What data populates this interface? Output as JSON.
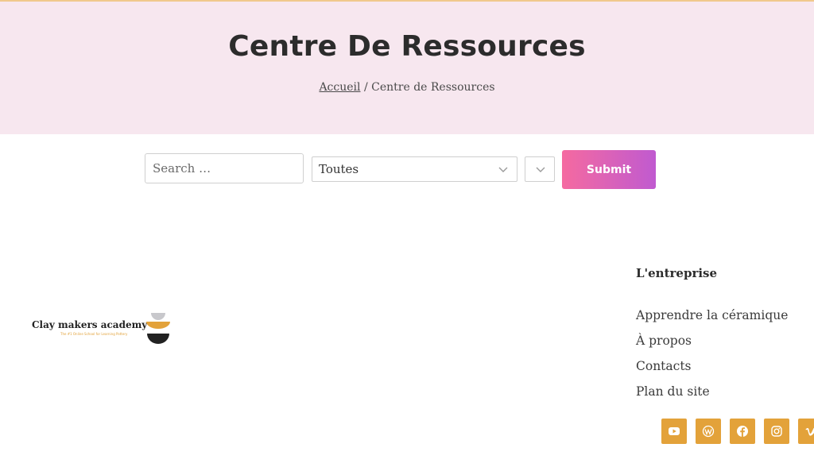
{
  "hero": {
    "title": "Centre De Ressources",
    "breadcrumb": {
      "home": "Accueil",
      "separator": "/",
      "current": "Centre de Ressources"
    }
  },
  "search": {
    "placeholder": "Search …",
    "category_value": "Toutes",
    "subcategory_value": "",
    "submit_label": "Submit"
  },
  "logo": {
    "brand": "Clay makers academy",
    "tagline": "The #1 Online School for Learning Pottery"
  },
  "footer": {
    "heading": "L'entreprise",
    "links": [
      "Apprendre la céramique",
      "À propos",
      "Contacts",
      "Plan du site"
    ],
    "socials": [
      "youtube-icon",
      "wordpress-icon",
      "facebook-icon",
      "instagram-icon",
      "vimeo-icon"
    ]
  },
  "colors": {
    "hero_bg": "#f7e7ef",
    "accent": "#e3a23a",
    "button_gradient_start": "#f56aa0",
    "button_gradient_end": "#c05ad0"
  }
}
